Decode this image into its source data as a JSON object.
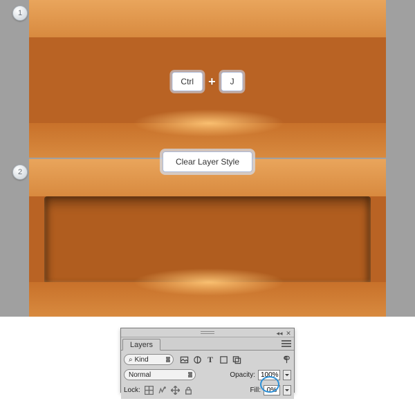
{
  "steps": {
    "badge1": "1",
    "badge2": "2",
    "key_ctrl": "Ctrl",
    "key_j": "J",
    "clear_style": "Clear Layer Style"
  },
  "layers_panel": {
    "tab_label": "Layers",
    "filter": {
      "search_icon": "⌕",
      "kind_label": "Kind"
    },
    "blend_mode": "Normal",
    "opacity_label": "Opacity:",
    "opacity_value": "100%",
    "lock_label": "Lock:",
    "fill_label": "Fill:",
    "fill_value": "0%",
    "window": {
      "collapse": "◂◂",
      "close": "✕"
    }
  }
}
